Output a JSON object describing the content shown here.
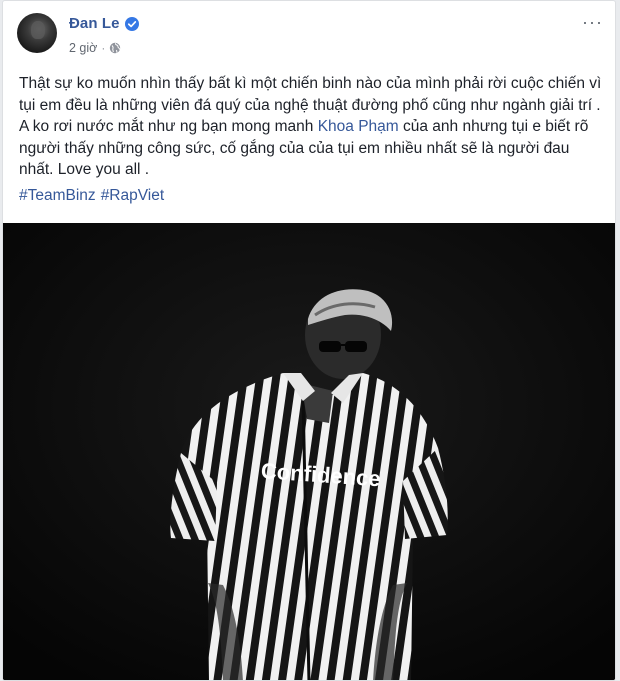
{
  "post": {
    "author": "Đan Le",
    "time": "2 giờ",
    "text_parts": [
      "Thật sự ko muốn nhìn thấy bất kì một chiến binh nào của mình phải rời cuộc chiến vì tụi em đều là những viên đá quý của nghệ thuật đường phố cũng như ngành giải trí . A ko rơi nước mắt như ng bạn mong manh ",
      "Khoa Phạm",
      " của anh nhưng tụi e biết rõ người thấy những công sức, cố gắng của của tụi em nhiều nhất sẽ là người đau nhất. Love you all ."
    ],
    "hashtags": [
      "#TeamBinz",
      "#RapViet"
    ],
    "more_label": "···",
    "photo_print": "Confidence"
  },
  "colors": {
    "link": "#365899",
    "text": "#1d2129",
    "meta": "#616770",
    "verified": "#3578e5",
    "photo_bg": "#080808"
  },
  "icons": {
    "verified": "verified-badge-icon",
    "privacy": "globe-icon",
    "more": "more-options-icon"
  }
}
